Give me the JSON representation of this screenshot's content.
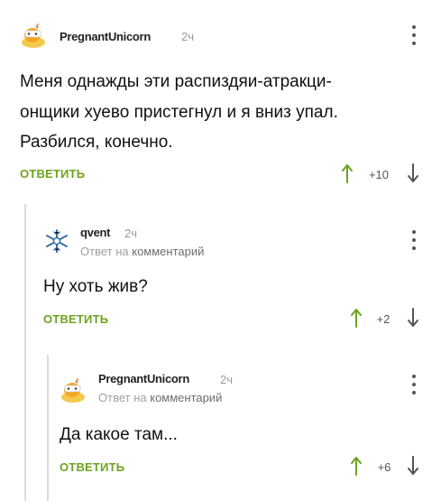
{
  "comments": [
    {
      "username": "PregnantUnicorn",
      "time": "2ч",
      "text_lines": [
        "Меня однажды эти распиздяи-атракци-",
        "онщики хуево пристегнул и я вниз упал.",
        "Разбился, конечно."
      ],
      "reply_label": "ОТВЕТИТЬ",
      "score": "+10",
      "avatar": "unicorn-avatar",
      "colors": {
        "up_arrow": "#6ca31f",
        "down_arrow": "#555555"
      }
    },
    {
      "username": "qvent",
      "time": "2ч",
      "reply_prefix": "Ответ на",
      "reply_link": "комментарий",
      "text_lines": [
        "Ну хоть жив?"
      ],
      "reply_label": "ОТВЕТИТЬ",
      "score": "+2",
      "avatar": "snowflake-avatar"
    },
    {
      "username": "PregnantUnicorn",
      "time": "2ч",
      "reply_prefix": "Ответ на",
      "reply_link": "комментарий",
      "text_lines": [
        "Да какое там..."
      ],
      "reply_label": "ОТВЕТИТЬ",
      "score": "+6",
      "avatar": "unicorn-avatar"
    }
  ],
  "theme": {
    "accent_green": "#6ca31f",
    "thread_line": "#dcdcdc",
    "muted_text": "#9a9a9a"
  }
}
